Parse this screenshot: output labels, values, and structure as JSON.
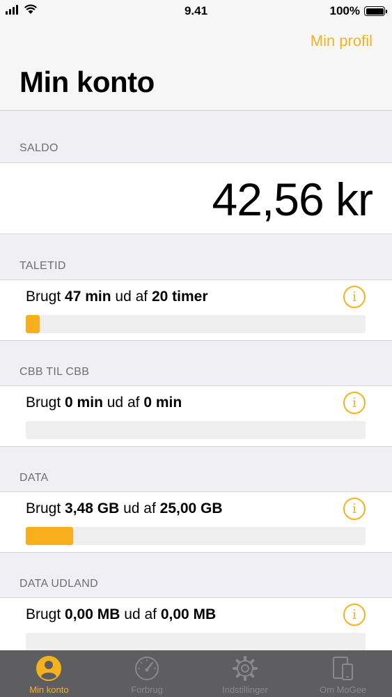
{
  "status_bar": {
    "time": "9.41",
    "battery": "100%"
  },
  "nav": {
    "profile_link": "Min profil",
    "title": "Min konto"
  },
  "balance": {
    "header": "SALDO",
    "value": "42,56 kr"
  },
  "usage": [
    {
      "header": "TALETID",
      "prefix": "Brugt",
      "used": "47 min",
      "middle": "ud af",
      "total": "20 timer",
      "progress": 0.04
    },
    {
      "header": "CBB TIL CBB",
      "prefix": "Brugt",
      "used": "0 min",
      "middle": "ud af",
      "total": "0 min",
      "progress": 0
    },
    {
      "header": "DATA",
      "prefix": "Brugt",
      "used": "3,48 GB",
      "middle": "ud af",
      "total": "25,00 GB",
      "progress": 0.139
    },
    {
      "header": "DATA UDLAND",
      "prefix": "Brugt",
      "used": "0,00 MB",
      "middle": "ud af",
      "total": "0,00 MB",
      "progress": 0
    }
  ],
  "tabs": [
    {
      "label": "Min konto",
      "icon": "person-icon",
      "active": true
    },
    {
      "label": "Forbrug",
      "icon": "speedometer-icon",
      "active": false
    },
    {
      "label": "Indstillinger",
      "icon": "gear-icon",
      "active": false
    },
    {
      "label": "Om MoGee",
      "icon": "devices-icon",
      "active": false
    }
  ],
  "colors": {
    "accent": "#f5b21f",
    "progress": "#f8ae1d",
    "tab_bar": "#5e5e60"
  }
}
